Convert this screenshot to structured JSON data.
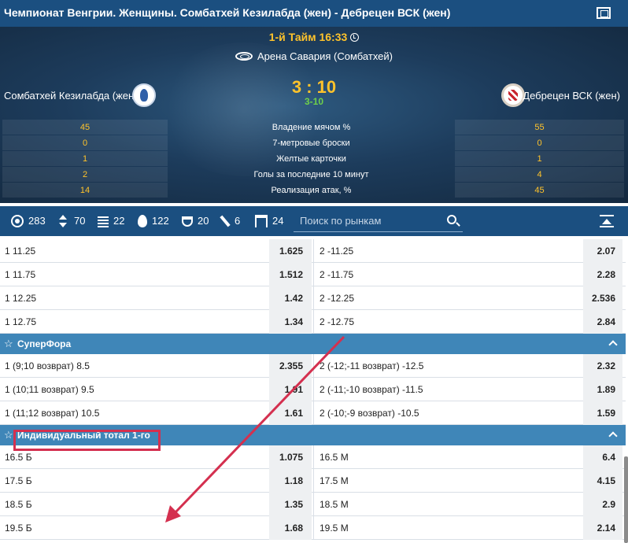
{
  "header": {
    "title": "Чемпионат Венгрии. Женщины. Сомбатхей Кезилабда (жен) - Дебрецен ВСК (жен)"
  },
  "match": {
    "period": "1-й Тайм 16:33",
    "venue": "Арена Савария (Сомбатхей)",
    "home_team": "Сомбатхей Кезилабда (жен)",
    "away_team": "Дебрецен ВСК (жен)",
    "score": "3 : 10",
    "subscore": "3-10"
  },
  "stats": [
    {
      "label": "Владение мячом %",
      "home": "45",
      "away": "55"
    },
    {
      "label": "7-метровые броски",
      "home": "0",
      "away": "0"
    },
    {
      "label": "Желтые карточки",
      "home": "1",
      "away": "1"
    },
    {
      "label": "Голы за последние 10 минут",
      "home": "2",
      "away": "4"
    },
    {
      "label": "Реализация атак, %",
      "home": "14",
      "away": "45"
    }
  ],
  "toolbar": {
    "all": "283",
    "totals": "70",
    "stats": "22",
    "hot": "122",
    "cups": "20",
    "sticks": "6",
    "gates": "24",
    "search_placeholder": "Поиск по рынкам"
  },
  "handicap_rows": [
    {
      "l": "1 11.25",
      "lo": "1.625",
      "r": "2 -11.25",
      "ro": "2.07"
    },
    {
      "l": "1 11.75",
      "lo": "1.512",
      "r": "2 -11.75",
      "ro": "2.28"
    },
    {
      "l": "1 12.25",
      "lo": "1.42",
      "r": "2 -12.25",
      "ro": "2.536"
    },
    {
      "l": "1 12.75",
      "lo": "1.34",
      "r": "2 -12.75",
      "ro": "2.84"
    }
  ],
  "superfora": {
    "title": "СуперФора",
    "rows": [
      {
        "l": "1 (9;10 возврат) 8.5",
        "lo": "2.355",
        "r": "2 (-12;-11 возврат) -12.5",
        "ro": "2.32"
      },
      {
        "l": "1 (10;11 возврат) 9.5",
        "lo": "1.91",
        "r": "2 (-11;-10 возврат) -11.5",
        "ro": "1.89"
      },
      {
        "l": "1 (11;12 возврат) 10.5",
        "lo": "1.61",
        "r": "2 (-10;-9 возврат) -10.5",
        "ro": "1.59"
      }
    ]
  },
  "individual_total": {
    "title": "Индивидуальный тотал 1-го",
    "rows": [
      {
        "l": "16.5 Б",
        "lo": "1.075",
        "r": "16.5 М",
        "ro": "6.4"
      },
      {
        "l": "17.5 Б",
        "lo": "1.18",
        "r": "17.5 М",
        "ro": "4.15"
      },
      {
        "l": "18.5 Б",
        "lo": "1.35",
        "r": "18.5 М",
        "ro": "2.9"
      },
      {
        "l": "19.5 Б",
        "lo": "1.68",
        "r": "19.5 М",
        "ro": "2.14"
      }
    ]
  },
  "colors": {
    "header_blue": "#1b4f80",
    "group_blue": "#3f86b8",
    "accent_yellow": "#ffc32b",
    "annotation_red": "#d4304f"
  }
}
